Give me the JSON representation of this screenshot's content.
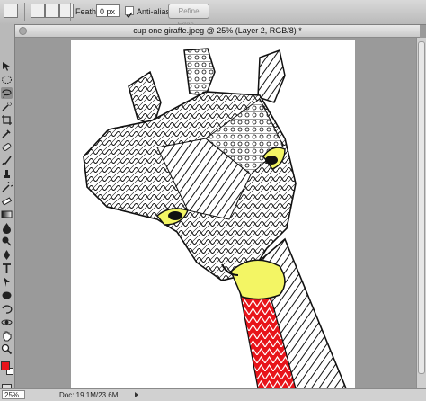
{
  "options_bar": {
    "style_value": "",
    "feather_label": "Feather:",
    "feather_value": "0 px",
    "anti_alias_label": "Anti-alias",
    "anti_alias_checked": true,
    "refine_edge_label": "Refine Edge..."
  },
  "document": {
    "tab_title": "cup one giraffe.jpeg @ 25% (Layer 2, RGB/8) *"
  },
  "status_bar": {
    "zoom": "25%",
    "doc_info": "Doc: 19.1M/23.6M"
  },
  "colors": {
    "foreground": "#e8141a",
    "background": "#ffffff",
    "accent_yellow": "#f3f564",
    "accent_red": "#e8141a"
  },
  "tools": [
    "move-tool",
    "marquee-tool",
    "lasso-tool",
    "quick-selection-tool",
    "crop-tool",
    "eyedropper-tool",
    "healing-brush-tool",
    "brush-tool",
    "clone-stamp-tool",
    "history-brush-tool",
    "eraser-tool",
    "gradient-tool",
    "blur-tool",
    "dodge-tool",
    "pen-tool",
    "type-tool",
    "path-selection-tool",
    "shape-tool",
    "3d-rotate-tool",
    "3d-orbit-tool",
    "hand-tool",
    "zoom-tool"
  ]
}
